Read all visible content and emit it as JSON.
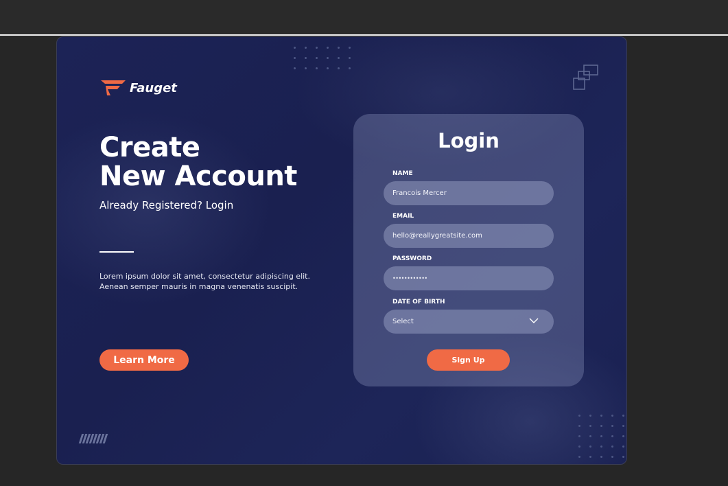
{
  "brand": {
    "name": "Fauget",
    "accent_color": "#f06a45",
    "background_color": "#1c2356",
    "logo_icon": "fauget-logo-icon"
  },
  "hero": {
    "headline_line1": "Create",
    "headline_line2": "New Account",
    "subhead": "Already Registered? Login",
    "body": "Lorem ipsum dolor sit amet, consectetur adipiscing elit. Aenean semper mauris in magna venenatis suscipit.",
    "cta_label": "Learn More"
  },
  "form": {
    "title": "Login",
    "name_label": "NAME",
    "name_value": "Francois Mercer",
    "email_label": "EMAIL",
    "email_value": "hello@reallygreatsite.com",
    "password_label": "PASSWORD",
    "password_value": "••••••••••••",
    "dob_label": "DATE OF BIRTH",
    "dob_value": "Select",
    "dob_icon": "chevron-down-icon",
    "submit_label": "Sign Up"
  }
}
